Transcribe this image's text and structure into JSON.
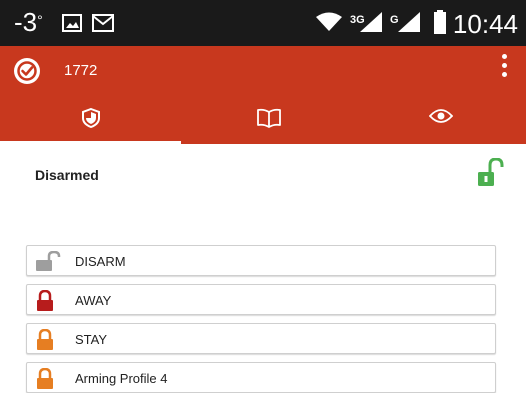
{
  "status_bar": {
    "temperature": "-3",
    "degree": "°",
    "network_3g": "3G",
    "network_g": "G",
    "time": "10:44"
  },
  "app_bar": {
    "title": "1772",
    "color": "#c8381e"
  },
  "tabs": [
    {
      "icon": "shield-icon",
      "selected": true
    },
    {
      "icon": "book-icon",
      "selected": false
    },
    {
      "icon": "eye-icon",
      "selected": false
    }
  ],
  "status": {
    "label": "Disarmed",
    "lock_color": "#4caf50"
  },
  "profiles": [
    {
      "label": "DISARM",
      "lock_color": "#9e9e9e",
      "locked": false
    },
    {
      "label": "AWAY",
      "lock_color": "#b71c1c",
      "locked": true
    },
    {
      "label": "STAY",
      "lock_color": "#e67e22",
      "locked": true
    },
    {
      "label": "Arming Profile 4",
      "lock_color": "#e67e22",
      "locked": true
    }
  ]
}
